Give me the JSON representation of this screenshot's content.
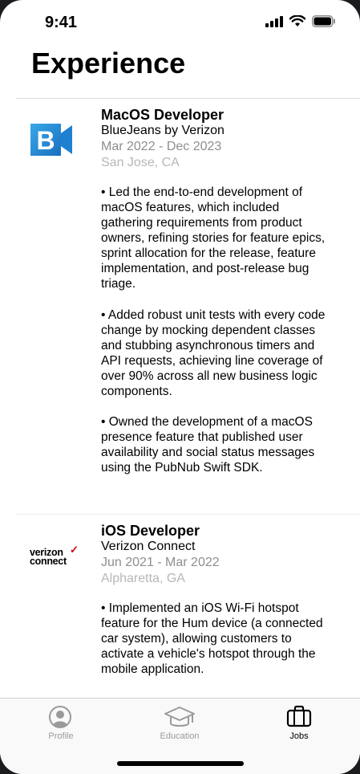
{
  "status": {
    "time": "9:41"
  },
  "page": {
    "title": "Experience"
  },
  "jobs": [
    {
      "title": "MacOS Developer",
      "company": "BlueJeans by Verizon",
      "dates": "Mar 2022 - Dec 2023",
      "location": "San Jose, CA",
      "logo_text": "B",
      "bullets": [
        "• Led the end-to-end development of macOS features, which included gathering requirements from product owners, refining stories for feature epics, sprint allocation for the release, feature implementation, and post-release bug triage.",
        "• Added robust unit tests with every code change by mocking dependent classes and stubbing asynchronous timers and API requests, achieving line coverage of over 90% across all new business logic components.",
        "• Owned the development of a macOS presence feature that published user availability and social status messages using the PubNub Swift SDK."
      ]
    },
    {
      "title": "iOS Developer",
      "company": "Verizon Connect",
      "dates": "Jun 2021 - Mar 2022",
      "location": "Alpharetta, GA",
      "logo_text_line1": "verizon",
      "logo_text_line2": "connect",
      "bullets": [
        "• Implemented an iOS Wi-Fi hotspot feature for the Hum device (a connected car system), allowing customers to activate a vehicle's hotspot through the mobile application."
      ]
    }
  ],
  "tabs": [
    {
      "label": "Profile",
      "icon": "person-circle-icon",
      "active": false
    },
    {
      "label": "Education",
      "icon": "graduation-cap-icon",
      "active": false
    },
    {
      "label": "Jobs",
      "icon": "briefcase-icon",
      "active": true
    }
  ],
  "colors": {
    "accent_blue": "#1a7ac9",
    "secondary_text": "#8e8e93",
    "tertiary_text": "#b7b7bb",
    "verizon_red": "#cd040b"
  }
}
